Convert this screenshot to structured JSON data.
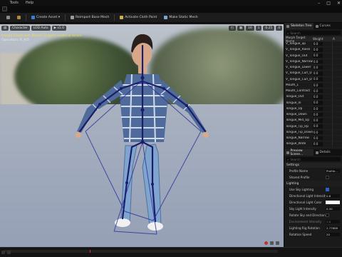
{
  "menu": {
    "tools": "Tools",
    "help": "Help"
  },
  "window": {
    "minimize": "–",
    "maximize": "□",
    "close": "✕"
  },
  "toolbar": {
    "create_asset": "Create Asset ▾",
    "reimport": "Reimport Base Mesh",
    "activate_cloth": "Activate Cloth Paint",
    "make_static": "Make Static Mesh"
  },
  "viewport": {
    "chips": [
      "▤",
      "Character",
      "LOD Auto",
      "▶ x1.0"
    ],
    "right_chips": [
      "◰",
      "▦",
      "10",
      "1",
      "0.25",
      "4"
    ],
    "message_warning": "Invalid (Used with Morph Targets) material errors",
    "message_info": "Operation: R_A/5"
  },
  "panel": {
    "tab_skeleton": "Skeleton Tree",
    "tab_curves": "Curves",
    "search_placeholder": "Search",
    "col_name": "Morph Target Name",
    "col_weight": "Weight",
    "col_extra": "A",
    "morphs": [
      {
        "name": "V_Tongue_up",
        "value": "0.0"
      },
      {
        "name": "V_Tongue_Raise",
        "value": "0.0"
      },
      {
        "name": "V_Tongue_Out",
        "value": "0.0"
      },
      {
        "name": "V_Tongue_Narrow",
        "value": "0.0"
      },
      {
        "name": "V_Tongue_Lower",
        "value": "0.0"
      },
      {
        "name": "V_Tongue_Curl_U",
        "value": "0.0"
      },
      {
        "name": "V_Tongue_Curl_D",
        "value": "0.0"
      },
      {
        "name": "Mouth_L",
        "value": "0.0"
      },
      {
        "name": "Mouth_Contract",
        "value": "0.0"
      },
      {
        "name": "Tongue_Out",
        "value": "0.0"
      },
      {
        "name": "Tongue_In",
        "value": "0.0"
      },
      {
        "name": "Tongue_Up",
        "value": "0.0"
      },
      {
        "name": "Tongue_Down",
        "value": "0.0"
      },
      {
        "name": "Tongue_Mid_Up",
        "value": "0.0"
      },
      {
        "name": "Tongue_Tip_Up",
        "value": "0.0"
      },
      {
        "name": "Tongue_Tip_Down",
        "value": "0.0"
      },
      {
        "name": "Tongue_Narrow",
        "value": "0.0"
      },
      {
        "name": "Tongue_Wide",
        "value": "0.0"
      }
    ],
    "tab_preview": "Preview Scene...",
    "tab_details": "Details",
    "settings_title": "Settings",
    "profile_name_label": "Profile Name",
    "profile_name_value": "Profile...",
    "shared_profile": "Shared Profile",
    "lighting": "Lighting",
    "use_sky": "Use Sky Lighting",
    "dir_light_intensity": "Directional Light Intensity",
    "dir_light_intensity_value": "0.6",
    "dir_light_color": "Directional Light Color",
    "sky_light_intensity": "Sky Light Intensity",
    "sky_light_intensity_value": "0.50",
    "rotate_sky": "Rotate Sky and Directional Lig...",
    "env_intensity": "Environment Intensity",
    "env_intensity_value": "1.0",
    "lighting_rig_rotation": "Lighting Rig Rotation",
    "lighting_rig_rotation_value": "2.77688",
    "rotation_speed": "Rotation Speed",
    "rotation_speed_value": "20"
  },
  "colors": {
    "accent_blue": "#2c62c8",
    "warning_text": "#f0e040",
    "record_red": "#c2322f",
    "bone_color": "#1b1d6b"
  }
}
